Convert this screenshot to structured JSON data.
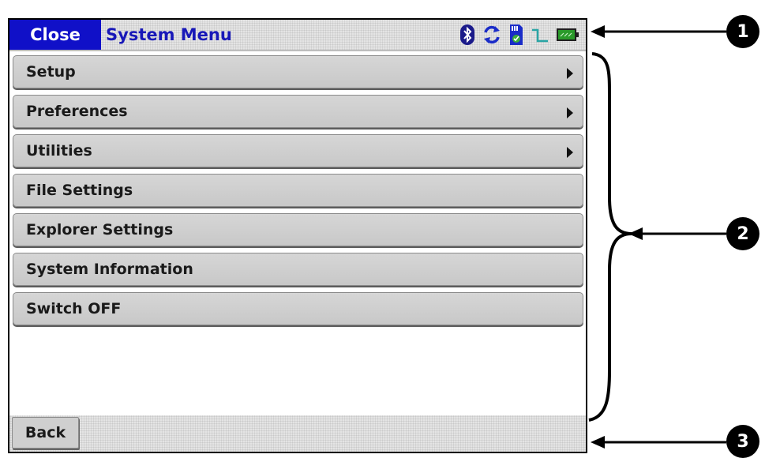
{
  "titlebar": {
    "close_label": "Close",
    "title": "System Menu",
    "icons": [
      "bluetooth-icon",
      "sync-icon",
      "sd-card-icon",
      "signal-icon",
      "battery-icon"
    ]
  },
  "menu": {
    "items": [
      {
        "label": "Setup",
        "has_submenu": true
      },
      {
        "label": "Preferences",
        "has_submenu": true
      },
      {
        "label": "Utilities",
        "has_submenu": true
      },
      {
        "label": "File Settings",
        "has_submenu": false
      },
      {
        "label": "Explorer Settings",
        "has_submenu": false
      },
      {
        "label": "System Information",
        "has_submenu": false
      },
      {
        "label": "Switch OFF",
        "has_submenu": false
      }
    ]
  },
  "bottombar": {
    "back_label": "Back"
  },
  "callouts": [
    "1",
    "2",
    "3"
  ],
  "colors": {
    "accent": "#1010c8",
    "title_text": "#1818b8",
    "menu_item_bg": "#cfcfcf",
    "battery": "#2a9a2a",
    "sd_card": "#1a2cc8"
  }
}
